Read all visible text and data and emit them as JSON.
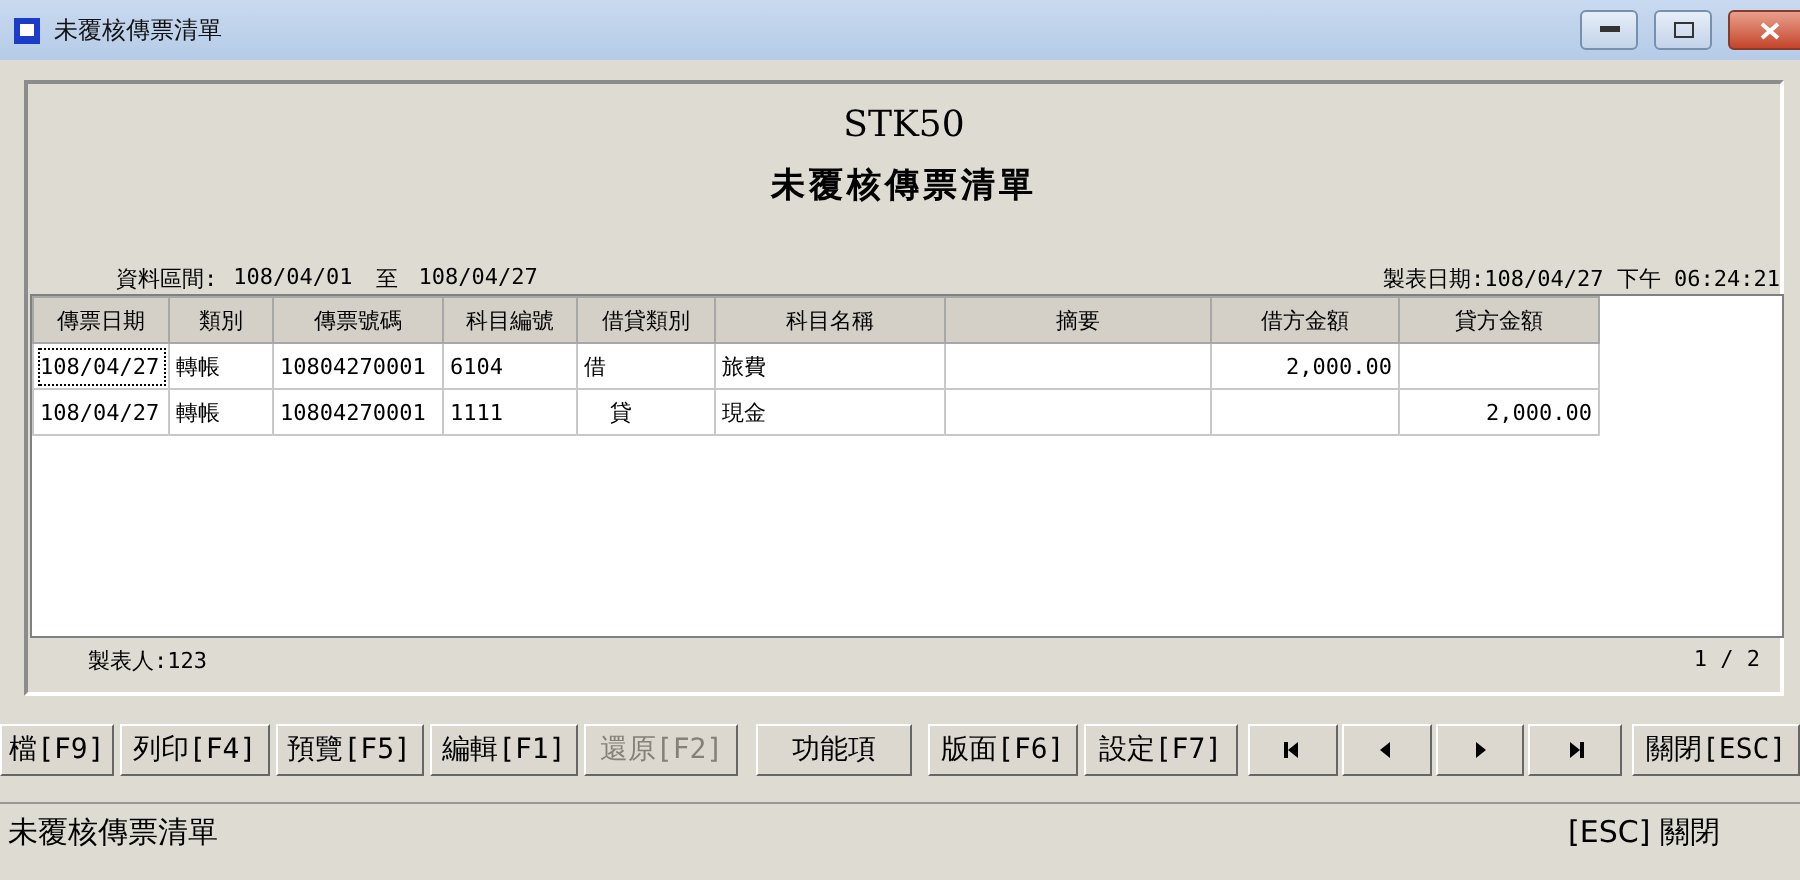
{
  "window": {
    "title": "未覆核傳票清單"
  },
  "report": {
    "code": "STK50",
    "title": "未覆核傳票清單",
    "range_label": "資料區間:",
    "range_from": "108/04/01",
    "range_sep": "至",
    "range_to": "108/04/27",
    "printed_at": "製表日期:108/04/27 下午 06:24:21",
    "maker": "製表人:123",
    "page": "1 / 2"
  },
  "table": {
    "columns": [
      "傳票日期",
      "類別",
      "傳票號碼",
      "科目編號",
      "借貸類別",
      "科目名稱",
      "摘要",
      "借方金額",
      "貸方金額"
    ],
    "rows": [
      {
        "focused": true,
        "cells": [
          "108/04/27",
          "轉帳",
          "10804270001",
          "6104",
          "借",
          "旅費",
          "",
          "2,000.00",
          ""
        ]
      },
      {
        "focused": false,
        "cells": [
          "108/04/27",
          "轉帳",
          "10804270001",
          "1111",
          "貸",
          "現金",
          "",
          "",
          "2,000.00"
        ]
      }
    ]
  },
  "toolbar": [
    {
      "kind": "text",
      "label": "檔[F9]",
      "disabled": false
    },
    {
      "kind": "text",
      "label": "列印[F4]",
      "disabled": false
    },
    {
      "kind": "text",
      "label": "預覽[F5]",
      "disabled": false
    },
    {
      "kind": "text",
      "label": "編輯[F1]",
      "disabled": false
    },
    {
      "kind": "text",
      "label": "還原[F2]",
      "disabled": true
    },
    {
      "kind": "text",
      "label": "功能項",
      "disabled": false
    },
    {
      "kind": "text",
      "label": "版面[F6]",
      "disabled": false
    },
    {
      "kind": "text",
      "label": "設定[F7]",
      "disabled": false
    },
    {
      "kind": "first",
      "disabled": false
    },
    {
      "kind": "prev",
      "disabled": false
    },
    {
      "kind": "next",
      "disabled": false
    },
    {
      "kind": "last",
      "disabled": false
    },
    {
      "kind": "text",
      "label": "關閉[ESC]",
      "disabled": false
    }
  ],
  "status_bar": {
    "left": "未覆核傳票清單",
    "right": "[ESC] 關閉"
  }
}
